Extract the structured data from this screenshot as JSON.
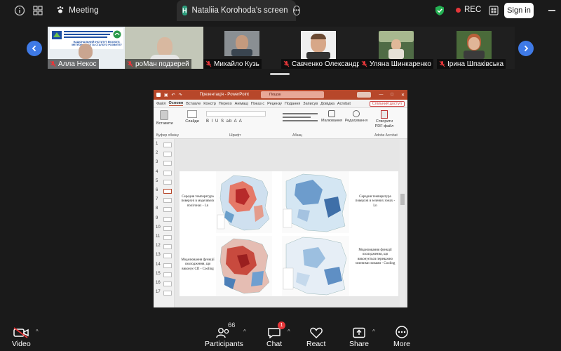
{
  "topbar": {
    "meeting_label": "Meeting",
    "share_tab_badge": "H",
    "share_tab_title": "Nataliia Korohoda's screen",
    "rec_label": "REC",
    "signin_label": "Sign in"
  },
  "participants": [
    {
      "name": "Алла Некос",
      "muted": true
    },
    {
      "name": "роМан подзерей",
      "muted": true
    },
    {
      "name": "Михайло Кузь",
      "muted": true
    },
    {
      "name": "Савченко Олександр",
      "muted": true
    },
    {
      "name": "Уляна Шинкаренко",
      "muted": true
    },
    {
      "name": "Ірина Шпаківська",
      "muted": true
    }
  ],
  "slide_banner_text": "НАЦІОНАЛЬНИЙ ІНСТИТУТ ЕКОЛОГІЇ, МЕТЕОРОЛОГІЇ ТА СТАЛОГО РОЗВИТКУ",
  "powerpoint": {
    "title": "Презентація - PowerPoint",
    "search_placeholder": "Пошук",
    "menu": [
      "Файл",
      "Основн",
      "Вставле",
      "Констр",
      "Перехо",
      "Анімаці",
      "Показ с",
      "Рецензу",
      "Подання",
      "Записув",
      "Довідка",
      "Acrobat"
    ],
    "share_button": "Спільний доступ",
    "ribbon": {
      "paste": "Вставити",
      "slides": "Слайди",
      "drawing": "Малювання",
      "editing": "Редагування",
      "create_pdf": "Створити PDF-файл",
      "group_clipboard": "Буфер обміну",
      "group_font": "Шрифт",
      "group_paragraph": "Абзац",
      "group_acrobat": "Adobe Acrobat"
    },
    "slide_numbers": [
      "1",
      "2",
      "3",
      "4",
      "5",
      "6",
      "7",
      "8",
      "9",
      "10",
      "11",
      "12",
      "13",
      "14",
      "15",
      "16",
      "17"
    ],
    "selected_slide": "6",
    "slide": {
      "text_tl": "Середня температура поверхні в моделямих полігонах - Ln",
      "text_bl": "Моделювання функції охолодження, що виконує СП - Cooling",
      "text_tr": "Середня температура поверхні в зелених зонах - Ln",
      "text_br": "Моделювання функції охолодження, що виконується переважно зеленими зонами - Cooling"
    }
  },
  "bottombar": {
    "video_label": "Video",
    "participants_label": "Participants",
    "participants_count": "66",
    "chat_label": "Chat",
    "chat_badge": "1",
    "react_label": "React",
    "share_label": "Share",
    "more_label": "More"
  },
  "colors": {
    "accent_blue": "#3f7ae6",
    "ppt_red": "#b7472a",
    "rec_red": "#e5373a"
  }
}
